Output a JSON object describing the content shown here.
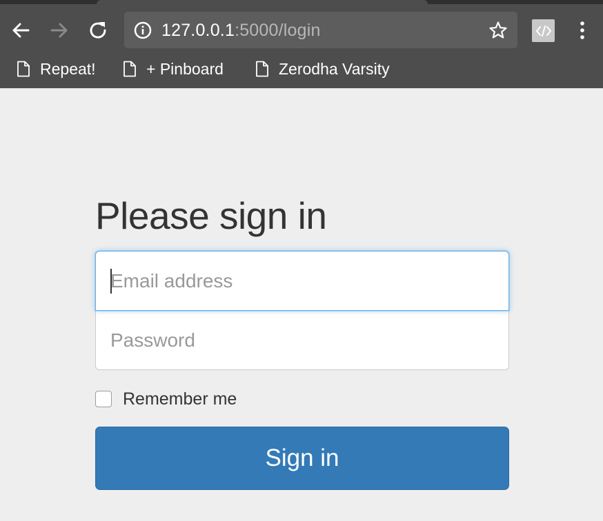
{
  "browser": {
    "url_host": "127.0.0.1",
    "url_rest": ":5000/login",
    "bookmarks": [
      {
        "label": "Repeat!"
      },
      {
        "label": "+ Pinboard"
      },
      {
        "label": "Zerodha Varsity"
      }
    ],
    "icons": [
      "back-arrow-icon",
      "forward-arrow-icon",
      "reload-icon",
      "info-icon",
      "star-icon",
      "code-extension-icon",
      "menu-dots-icon",
      "document-icon"
    ]
  },
  "form": {
    "heading": "Please sign in",
    "email_placeholder": "Email address",
    "password_placeholder": "Password",
    "remember_label": "Remember me",
    "remember_checked": false,
    "submit_label": "Sign in"
  },
  "colors": {
    "primary_button": "#337ab7",
    "focus_ring": "#66afe9",
    "page_background": "#eeeeee",
    "chrome_background": "#4d4d4d"
  }
}
